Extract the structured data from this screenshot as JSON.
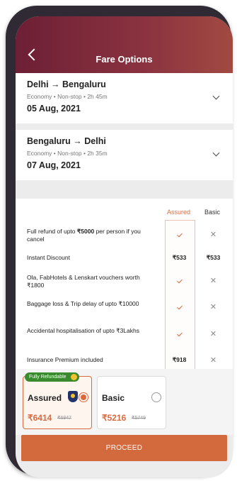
{
  "header": {
    "title": "Fare Options"
  },
  "trips": [
    {
      "route": "Delhi → Bengaluru",
      "meta": "Economy  •  Non-stop  •  2h 45m",
      "date": "05 Aug, 2021"
    },
    {
      "route": "Bengaluru → Delhi",
      "meta": "Economy  •  Non-stop  •  2h 35m",
      "date": "07 Aug, 2021"
    }
  ],
  "comparison": {
    "col_assured": "Assured",
    "col_basic": "Basic",
    "rows": [
      {
        "pre": "Full refund of upto ",
        "bold": "₹5000",
        "post": " per person if you cancel",
        "assured": "tick",
        "basic": "✕"
      },
      {
        "pre": "Instant Discount",
        "bold": "",
        "post": "",
        "assured": "₹533",
        "basic": "₹533"
      },
      {
        "pre": "Ola, FabHotels & Lenskart vouchers worth ₹1800",
        "bold": "",
        "post": "",
        "assured": "tick",
        "basic": "✕"
      },
      {
        "pre": "Baggage loss & Trip delay of upto ₹10000",
        "bold": "",
        "post": "",
        "assured": "tick",
        "basic": "✕"
      },
      {
        "pre": "Accidental hospitalisation of upto ₹3Lakhs",
        "bold": "",
        "post": "",
        "assured": "tick",
        "basic": "✕"
      },
      {
        "pre": "Insurance Premium included",
        "bold": "",
        "post": "",
        "assured": "₹918",
        "basic": "✕"
      }
    ]
  },
  "plans": {
    "assured": {
      "badge": "Fully Refundable",
      "name": "Assured",
      "price": "₹6414",
      "old_price": "₹6947",
      "selected": true
    },
    "basic": {
      "name": "Basic",
      "price": "₹5216",
      "old_price": "₹5749",
      "selected": false
    }
  },
  "proceed_label": "PROCEED",
  "colors": {
    "accent": "#d9693f",
    "header_start": "#6d1f35",
    "header_end": "#a14a42",
    "badge": "#3a8b2e"
  }
}
